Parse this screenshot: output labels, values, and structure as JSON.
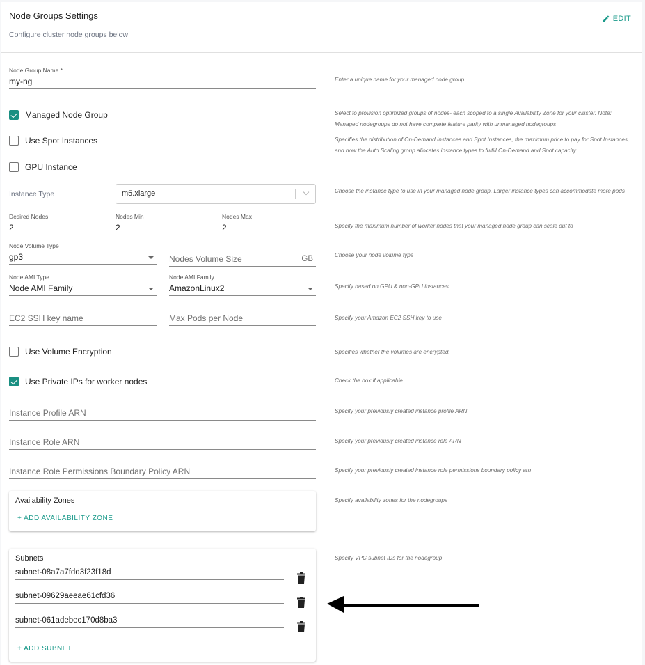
{
  "header": {
    "title": "Node Groups Settings",
    "subtitle": "Configure cluster node groups below",
    "edit_label": "EDIT"
  },
  "fields": {
    "node_group_name": {
      "label": "Node Group Name *",
      "value": "my-ng",
      "hint": "Enter a unique name for your managed node group"
    },
    "managed_node_group": {
      "label": "Managed Node Group",
      "checked": true,
      "hint": "Select to provision optimized groups of nodes- each scoped to a single Availability Zone for your cluster. Note: Managed nodegroups do not have complete feature parity with unmanaged nodegroups"
    },
    "use_spot_instances": {
      "label": "Use Spot Instances",
      "checked": false,
      "hint": "Specifies the distribution of On-Demand Instances and Spot Instances, the maximum price to pay for Spot Instances, and how the Auto Scaling group allocates instance types to fulfill On-Demand and Spot capacity."
    },
    "gpu_instance": {
      "label": "GPU Instance",
      "checked": false
    },
    "instance_type": {
      "label": "Instance Type",
      "value": "m5.xlarge",
      "hint": "Choose the instance type to use in your managed node group. Larger instance types can accommodate more pods"
    },
    "desired_nodes": {
      "label": "Desired Nodes",
      "value": "2"
    },
    "nodes_min": {
      "label": "Nodes Min",
      "value": "2"
    },
    "nodes_max": {
      "label": "Nodes Max",
      "value": "2",
      "hint": "Specify the maximum number of worker nodes that your managed node group can scale out to"
    },
    "node_volume_type": {
      "label": "Node Volume Type",
      "value": "gp3",
      "hint": "Choose your node volume type"
    },
    "nodes_volume_size": {
      "placeholder": "Nodes Volume Size",
      "unit": "GB"
    },
    "node_ami_type": {
      "label": "Node AMI Type",
      "value": "Node AMI Family",
      "hint": "Specify based on GPU & non-GPU instances"
    },
    "node_ami_family": {
      "label": "Node AMI Family",
      "value": "AmazonLinux2"
    },
    "ec2_ssh_key_name": {
      "placeholder": "EC2 SSH key name",
      "hint": "Specify your Amazon EC2 SSH key to use"
    },
    "max_pods_per_node": {
      "placeholder": "Max Pods per Node"
    },
    "use_volume_encryption": {
      "label": "Use Volume Encryption",
      "checked": false,
      "hint": "Specifies whether the volumes are encrypted."
    },
    "use_private_ips": {
      "label": "Use Private IPs for worker nodes",
      "checked": true,
      "hint": "Check the box if applicable"
    },
    "instance_profile_arn": {
      "placeholder": "Instance Profile ARN",
      "hint": "Specify your previously created instance profile ARN"
    },
    "instance_role_arn": {
      "placeholder": "Instance Role ARN",
      "hint": "Specify your previously created instance role ARN"
    },
    "instance_role_permissions_boundary": {
      "placeholder": "Instance Role Permissions Boundary Policy ARN",
      "hint": "Specify your previously created instance role permissions boundary policy arn"
    }
  },
  "availability_zones": {
    "title": "Availability Zones",
    "add_label": "+ ADD  AVAILABILITY ZONE",
    "hint": "Specify availability zones for the nodegroups"
  },
  "subnets": {
    "title": "Subnets",
    "items": [
      "subnet-08a7a7fdd3f23f18d",
      "subnet-09629aeeae61cfd36",
      "subnet-061adebec170d8ba3"
    ],
    "add_label": "+ ADD  SUBNET",
    "hint": "Specify VPC subnet IDs for the nodegroup"
  },
  "colors": {
    "accent": "#1a9a8a",
    "checkbox_checked": "#1a8f82",
    "hint_text": "#6b6b6b"
  }
}
